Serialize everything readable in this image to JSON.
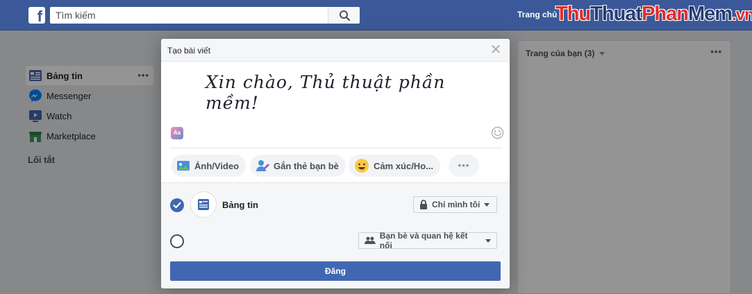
{
  "topbar": {
    "logo": "f",
    "search_placeholder": "Tìm kiếm",
    "home_link": "Trang chủ"
  },
  "watermark": {
    "part1": "Thu",
    "part2": "Thuat",
    "part3": "Phan",
    "part4": "Mem",
    "part5": ".vn"
  },
  "sidebar": {
    "items": [
      {
        "label": "Bảng tin",
        "icon": "news-feed-icon",
        "active": true
      },
      {
        "label": "Messenger",
        "icon": "messenger-icon"
      },
      {
        "label": "Watch",
        "icon": "watch-icon"
      },
      {
        "label": "Marketplace",
        "icon": "marketplace-icon"
      }
    ],
    "more": "•••",
    "shortcuts_label": "Lối tắt"
  },
  "right_panel": {
    "title": "Trang của bạn (3)",
    "more": "•••"
  },
  "modal": {
    "title": "Tạo bài viết",
    "close": "✕",
    "post_text": "Xin chào, Thủ thuật phần mềm!",
    "text_style_icon": "Aa",
    "actions": [
      {
        "label": "Ảnh/Video",
        "icon": "photo-icon"
      },
      {
        "label": "Gắn thẻ bạn bè",
        "icon": "tag-friends-icon"
      },
      {
        "label": "Cảm xúc/Ho...",
        "icon": "feeling-icon"
      }
    ],
    "more_actions": "•••",
    "destinations": {
      "feed_label": "Bảng tin",
      "feed_privacy": "Chỉ mình tôi",
      "story_privacy": "Bạn bè và quan hệ kết nối"
    },
    "post_button": "Đăng"
  },
  "colors": {
    "topbar": "#3b5998",
    "primary": "#4267b2",
    "watermark_red": "#e02d2d",
    "watermark_dark": "#283b72"
  }
}
